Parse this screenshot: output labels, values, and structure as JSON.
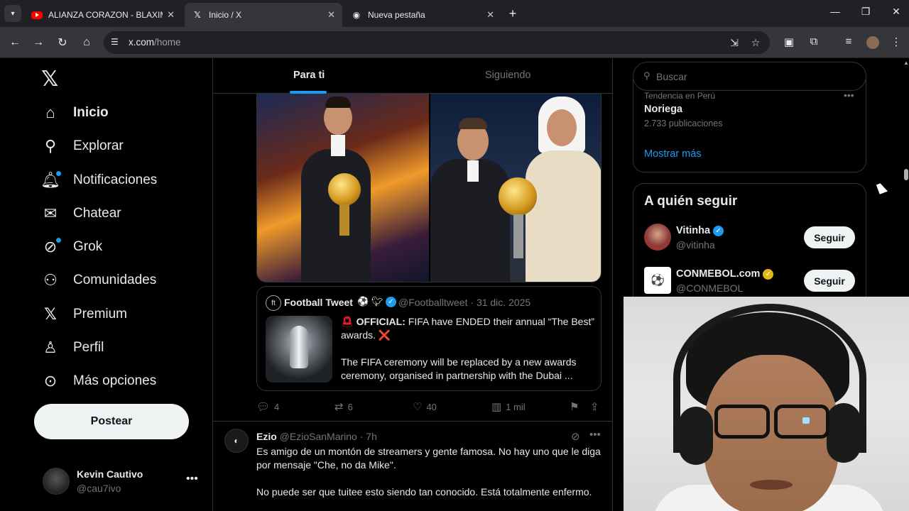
{
  "browser": {
    "tabs": [
      {
        "title": "ALIANZA CORAZON - BLAXIME",
        "favicon": "youtube-icon"
      },
      {
        "title": "Inicio / X",
        "favicon": "x-icon"
      },
      {
        "title": "Nueva pestaña",
        "favicon": "chrome-icon"
      }
    ],
    "active_tab": 1,
    "url_domain": "x.com",
    "url_path": "/home"
  },
  "nav": {
    "items": [
      {
        "label": "Inicio",
        "icon": "home-icon",
        "active": true
      },
      {
        "label": "Explorar",
        "icon": "search-icon"
      },
      {
        "label": "Notificaciones",
        "icon": "bell-icon",
        "dot": true
      },
      {
        "label": "Chatear",
        "icon": "mail-icon"
      },
      {
        "label": "Grok",
        "icon": "grok-icon",
        "dot": true
      },
      {
        "label": "Comunidades",
        "icon": "people-icon"
      },
      {
        "label": "Premium",
        "icon": "x-icon"
      },
      {
        "label": "Perfil",
        "icon": "person-icon"
      },
      {
        "label": "Más opciones",
        "icon": "more-circle-icon"
      }
    ],
    "post_button": "Postear",
    "account": {
      "name": "Kevin Cautivo",
      "handle": "@cau7ivo"
    }
  },
  "timeline": {
    "tabs": [
      "Para ti",
      "Siguiendo"
    ],
    "active_tab": 0,
    "post1": {
      "quote": {
        "name": "Football Tweet",
        "handle": "@Footballtweet",
        "date": "31 dic. 2025",
        "text_official": "OFFICIAL:",
        "text_line1": " FIFA have ENDED their annual “The Best” awards. ❌",
        "text_line2": "The FIFA ceremony will be replaced by a new awards ceremony, organised in partnership with the Dubai ..."
      },
      "actions": {
        "replies": "4",
        "reposts": "6",
        "likes": "40",
        "views": "1 mil"
      }
    },
    "post2": {
      "name": "Ezio",
      "handle": "@EzioSanMarino",
      "time": "7h",
      "para1": "Es amigo de un montón de streamers y gente famosa. No hay uno que le diga por mensaje \"Che, no da Mike\".",
      "para2": "No puede ser que tuitee esto siendo tan conocido. Está totalmente enfermo."
    }
  },
  "sidebar": {
    "search_placeholder": "Buscar",
    "trend": {
      "context": "Tendencia en Perú",
      "name": "Noriega",
      "count": "2.733 publicaciones"
    },
    "show_more": "Mostrar más",
    "who_to_follow_title": "A quién seguir",
    "suggestions": [
      {
        "name": "Vitinha",
        "handle": "@vitinha",
        "badge": "blue",
        "button": "Seguir"
      },
      {
        "name": "CONMEBOL.com",
        "handle": "@CONMEBOL",
        "badge": "gold",
        "button": "Seguir"
      }
    ]
  },
  "colors": {
    "accent": "#1d9bf0",
    "background": "#000000",
    "border": "#2f3336",
    "muted": "#71767b"
  }
}
